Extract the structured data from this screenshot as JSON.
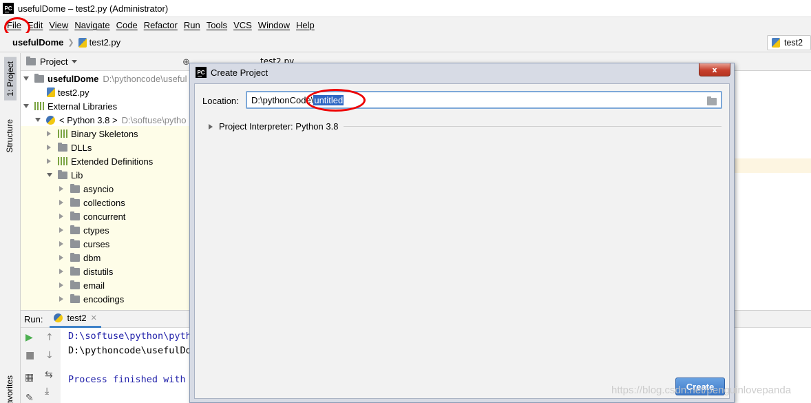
{
  "window": {
    "title": "usefulDome – test2.py (Administrator)",
    "logo_text": "PC"
  },
  "menu": [
    "File",
    "Edit",
    "View",
    "Navigate",
    "Code",
    "Refactor",
    "Run",
    "Tools",
    "VCS",
    "Window",
    "Help"
  ],
  "breadcrumb": {
    "project": "usefulDome",
    "file": "test2.py"
  },
  "run_config": {
    "label": "test2"
  },
  "left_stripe": {
    "project_tab": "1: Project",
    "structure_tab": "Structure",
    "favorites_tab": "avorites"
  },
  "project_panel": {
    "title": "Project",
    "tree": [
      {
        "label": "usefulDome",
        "path": "D:\\pythoncode\\useful",
        "bold": true
      },
      {
        "label": "test2.py"
      },
      {
        "label": "External Libraries"
      },
      {
        "label": "< Python 3.8 >",
        "path": "D:\\softuse\\pytho"
      },
      {
        "label": "Binary Skeletons"
      },
      {
        "label": "DLLs"
      },
      {
        "label": "Extended Definitions"
      },
      {
        "label": "Lib"
      },
      {
        "label": "asyncio"
      },
      {
        "label": "collections"
      },
      {
        "label": "concurrent"
      },
      {
        "label": "ctypes"
      },
      {
        "label": "curses"
      },
      {
        "label": "dbm"
      },
      {
        "label": "distutils"
      },
      {
        "label": "email"
      },
      {
        "label": "encodings"
      }
    ]
  },
  "editor_tab": {
    "label": "test2.py"
  },
  "run_panel": {
    "label": "Run:",
    "tab": "test2",
    "console": [
      "D:\\softuse\\python\\pyth",
      "D:\\pythoncode\\usefulDo",
      "Process finished with"
    ]
  },
  "dialog": {
    "title": "Create Project",
    "close_label": "x",
    "location_label": "Location:",
    "location_prefix": "D:\\pythonCode\\",
    "location_selected": "untitled",
    "interpreter_label": "Project Interpreter: Python 3.8",
    "create_button": "Create"
  },
  "watermark": "https://blog.csdn.net/penguinlovepanda",
  "colors": {
    "annotation": "#e00000",
    "selection": "#2e67c4",
    "create_button": "#3c78c8"
  }
}
